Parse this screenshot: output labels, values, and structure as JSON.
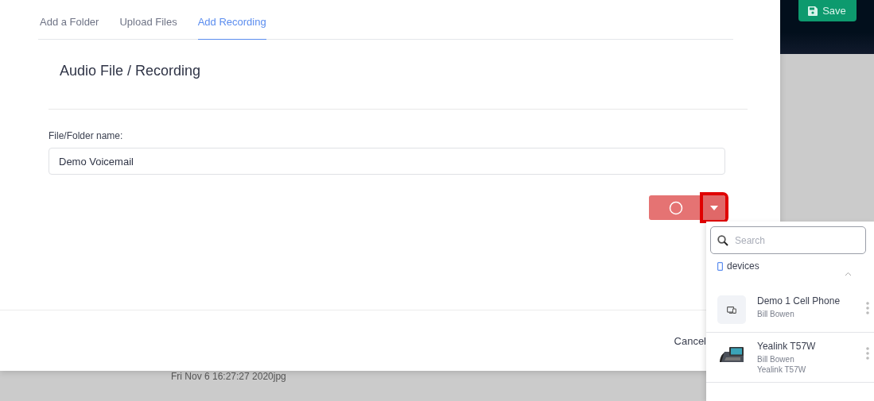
{
  "header": {
    "save_button": "Save"
  },
  "tabs": [
    {
      "label": "Add a Folder",
      "selected": false
    },
    {
      "label": "Upload Files",
      "selected": false
    },
    {
      "label": "Add Recording",
      "selected": true
    }
  ],
  "panel": {
    "title": "Audio File / Recording",
    "name_label": "File/Folder name:",
    "name_value": "Demo Voicemail"
  },
  "record_button": {
    "dropdown_highlighted": true
  },
  "footer": {
    "cancel_button": "Cancel"
  },
  "background": {
    "file_label": "Fri Nov 6 16:27:27 2020jpg"
  },
  "device_menu": {
    "search_placeholder": "Search",
    "group": {
      "label": "devices",
      "expanded": true
    },
    "devices": [
      {
        "name": "Demo 1 Cell Phone",
        "details": [
          "Bill Bowen"
        ],
        "kind": "generic"
      },
      {
        "name": "Yealink T57W",
        "details": [
          "Bill Bowen",
          "Yealink T57W"
        ],
        "kind": "desk-phone"
      }
    ]
  }
}
